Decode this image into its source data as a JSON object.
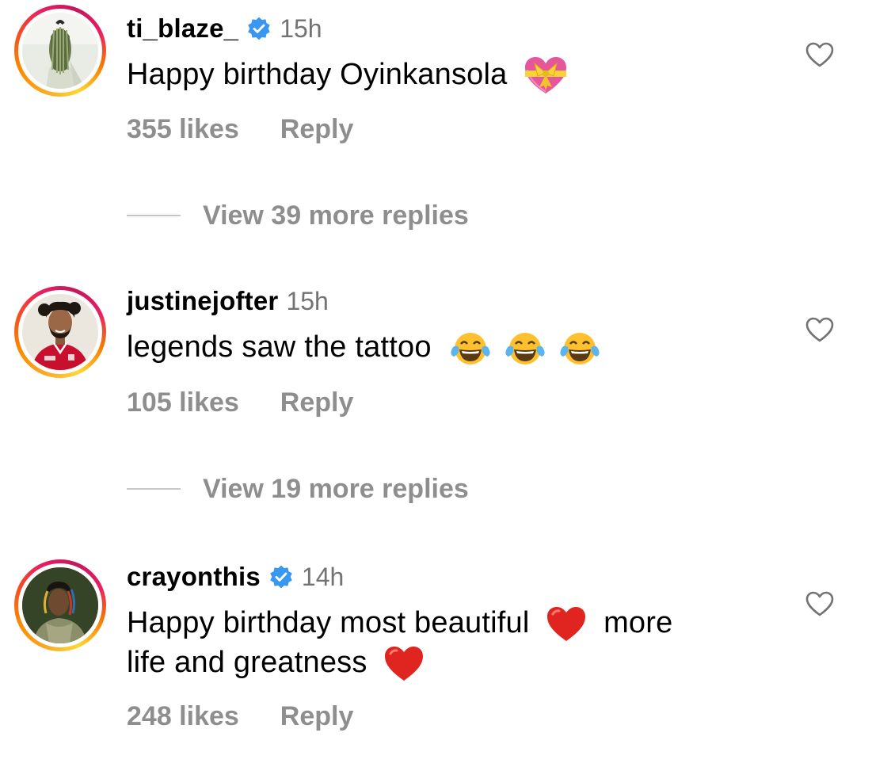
{
  "comments": [
    {
      "username": "ti_blaze_",
      "verified": true,
      "time": "15h",
      "text": "Happy birthday Oyinkansola",
      "likes": "355 likes",
      "reply": "Reply",
      "view_replies": "View 39 more replies",
      "emojis": [
        "gift-heart"
      ]
    },
    {
      "username": "justinejofter",
      "verified": false,
      "time": "15h",
      "text": "legends saw the tattoo",
      "likes": "105 likes",
      "reply": "Reply",
      "view_replies": "View 19 more replies",
      "emojis": [
        "tears-of-joy",
        "tears-of-joy",
        "tears-of-joy"
      ]
    },
    {
      "username": "crayonthis",
      "verified": true,
      "time": "14h",
      "text_line1": "Happy birthday most beautiful",
      "text_line1_after": "more",
      "text_line2": "life and greatness",
      "likes": "248 likes",
      "reply": "Reply",
      "emojis": [
        "red-heart",
        "red-heart"
      ]
    }
  ],
  "colors": {
    "verified": "#3897f0",
    "secondary_text": "#8e8e8e",
    "time_text": "#737373"
  }
}
